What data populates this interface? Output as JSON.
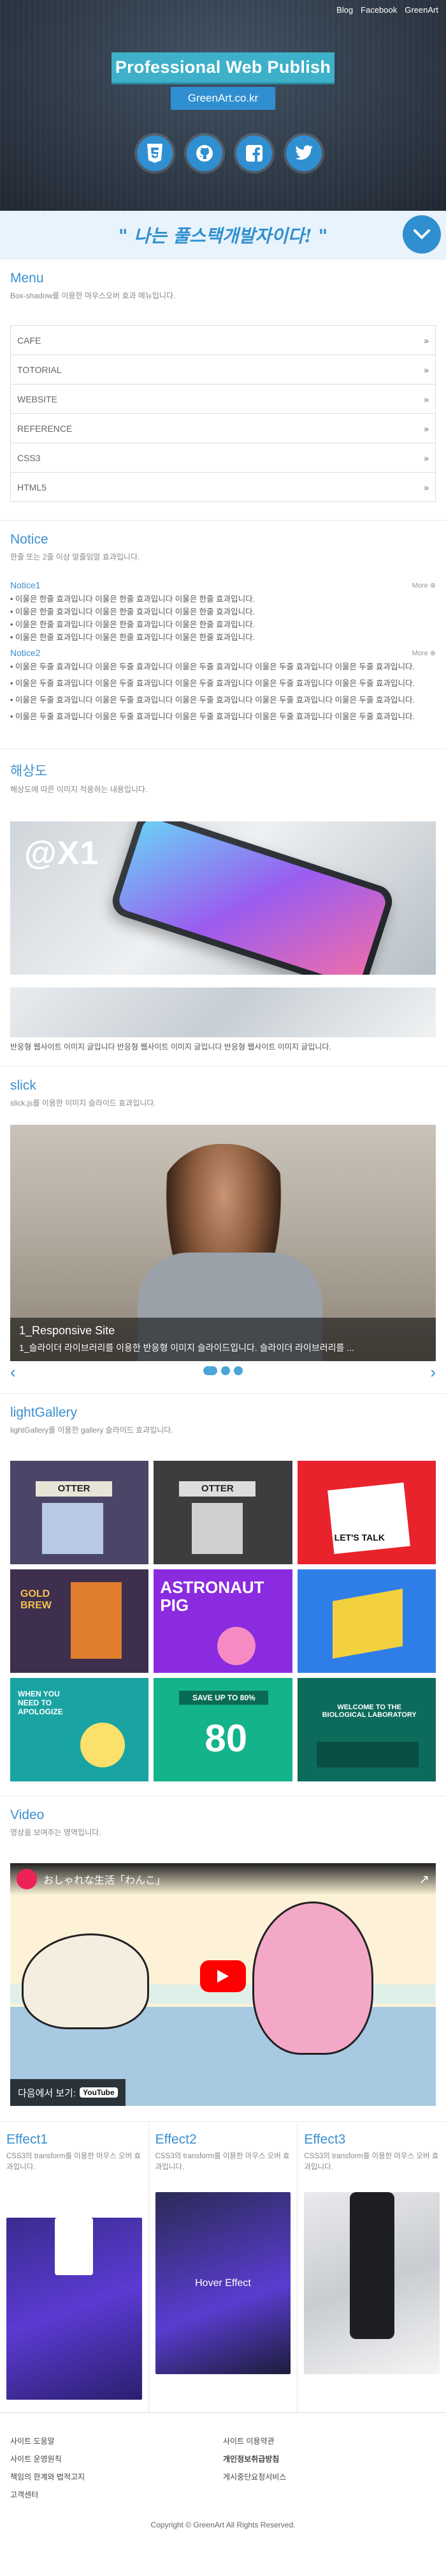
{
  "topnav": [
    "Blog",
    "Facebook",
    "GreenArt"
  ],
  "header": {
    "title": "Professional Web Publish",
    "subtitle": "GreenArt.co.kr",
    "icons": [
      "html5-icon",
      "github-icon",
      "facebook-icon",
      "twitter-icon"
    ]
  },
  "slogan": "\" 나는 풀스택개발자이다! \"",
  "menu": {
    "title": "Menu",
    "desc": "Box-shadow를 이용한 마우스오버 효과 메뉴입니다.",
    "items": [
      "CAFE",
      "TOTORIAL",
      "WEBSITE",
      "REFERENCE",
      "CSS3",
      "HTML5"
    ],
    "arrow": "»"
  },
  "notice": {
    "title": "Notice",
    "desc": "한줄 또는 2줄 이상 말줄임말 효과입니다.",
    "more": "More",
    "groups": [
      {
        "head": "Notice1",
        "lines": [
          "이울은 한줄 효과입니다 이울은 한줄 효과입니다 이울은 한줄 효과입니다.",
          "이울은 한줄 효과입니다 이울은 한줄 효과입니다 이울은 한줄 효과입니다.",
          "이울은 한줄 효과입니다 이울은 한줄 효과입니다 이울은 한줄 효과입니다.",
          "이울은 한줄 효과입니다 이울은 한줄 효과입니다 이울은 한줄 효과입니다."
        ]
      },
      {
        "head": "Notice2",
        "lines": [
          "이울은 두줄 효과입니다 이울은 두줄 효과입니다 이울은 두줄 효과입니다 이울은 두줄 효과입니다 이울은 두줄 효과입니다.",
          "이울은 두줄 효과입니다 이울은 두줄 효과입니다 이울은 두줄 효과입니다 이울은 두줄 효과입니다 이울은 두줄 효과입니다.",
          "이울은 두줄 효과입니다 이울은 두줄 효과입니다 이울은 두줄 효과입니다 이울은 두줄 효과입니다 이울은 두줄 효과입니다.",
          "이울은 두줄 효과입니다 이울은 두줄 효과입니다 이울은 두줄 효과입니다 이울은 두줄 효과입니다 이울은 두줄 효과입니다."
        ]
      }
    ]
  },
  "resolution": {
    "title": "해상도",
    "desc": "해상도에 따른 이미지 적용하는 내용입니다.",
    "badge": "@X1",
    "caption": "반응형 웹사이트 이미지 글입니다 반응형 웹사이트 이미지 글입니다 반응형 웹사이트 이미지 글입니다."
  },
  "slick": {
    "title": "slick",
    "desc": "slick.js를 이용한 이미지 슬라이드 효과입니다.",
    "slide_title": "1_Responsive Site",
    "slide_text": "1_슬라이더 라이브러리를 이용한 반응형 이미지 슬라이드입니다. 슬라이더 라이브러리를 ..."
  },
  "gallery": {
    "title": "lightGallery",
    "desc": "lightGallery를 이용한 gallery 슬라이드 효과입니다.",
    "items": [
      "OTTER",
      "OTTER",
      "LET'S TALK",
      "GOLD BREW",
      "ASTRONAUT PIG",
      "",
      "WHEN YOU NEED TO APOLOGIZE",
      "SAVE UP TO 80%",
      "WELCOME TO THE BIOLOGICAL LABORATORY"
    ]
  },
  "video": {
    "title": "Video",
    "desc": "영상을 보여주는 영역입니다.",
    "video_title": "おしゃれな生活「わんこ」",
    "watch_label": "다음에서 보기:",
    "platform": "YouTube"
  },
  "effects": [
    {
      "title": "Effect1",
      "desc": "CSS3의 transform를 이용한 마우스 오버 효과입니다.",
      "overlay": ""
    },
    {
      "title": "Effect2",
      "desc": "CSS3의 transform를 이용한 마우스 오버 효과입니다.",
      "overlay": "Hover Effect"
    },
    {
      "title": "Effect3",
      "desc": "CSS3의 transform를 이용한 마우스 오버 효과입니다.",
      "overlay": ""
    }
  ],
  "footer": {
    "links_left": [
      "사이트 도움말",
      "사이트 운영원칙",
      "책임의 한계와 법적고지",
      "고객센터"
    ],
    "links_right": [
      "사이트 이용약관",
      "개인정보취급방침",
      "게시중단요청서비스"
    ],
    "copyright": "Copyright © GreenArt All Rights Reserved."
  },
  "colors": {
    "accent": "#2f8fd1",
    "title_box": "#3fb0c9"
  }
}
